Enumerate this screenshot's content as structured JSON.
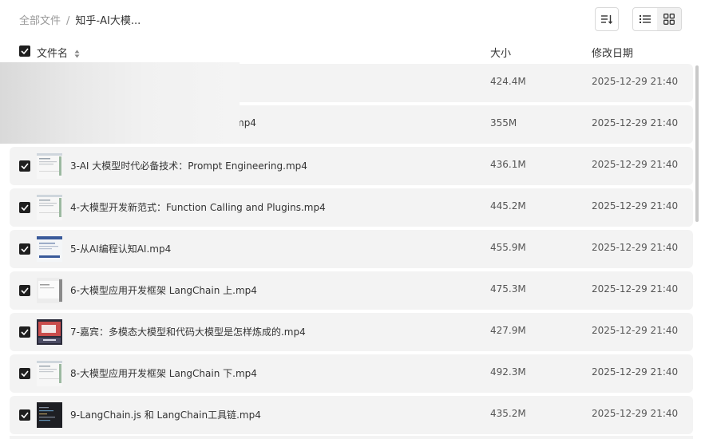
{
  "breadcrumb": {
    "root": "全部文件",
    "separator": "/",
    "current": "知乎-AI大模..."
  },
  "columns": {
    "name": "文件名",
    "size": "大小",
    "modified": "修改日期"
  },
  "files": [
    {
      "name": "",
      "name_suffix": "",
      "size": "424.4M",
      "date": "2025-12-29 21:40",
      "checked": true,
      "thumb": "blurred"
    },
    {
      "name": "",
      "name_suffix": "mp4",
      "size": "355M",
      "date": "2025-12-29 21:40",
      "checked": true,
      "thumb": "blurred"
    },
    {
      "name": "3-AI 大模型时代必备技术：Prompt Engineering.mp4",
      "size": "436.1M",
      "date": "2025-12-29 21:40",
      "checked": true,
      "thumb": "light"
    },
    {
      "name": "4-大模型开发新范式：Function Calling and Plugins.mp4",
      "size": "445.2M",
      "date": "2025-12-29 21:40",
      "checked": true,
      "thumb": "light"
    },
    {
      "name": "5-从AI编程认知AI.mp4",
      "size": "455.9M",
      "date": "2025-12-29 21:40",
      "checked": true,
      "thumb": "slide-blue"
    },
    {
      "name": "6-大模型应用开发框架 LangChain 上.mp4",
      "size": "475.3M",
      "date": "2025-12-29 21:40",
      "checked": true,
      "thumb": "light-gray"
    },
    {
      "name": "7-嘉宾：多模态大模型和代码大模型是怎样炼成的.mp4",
      "size": "427.9M",
      "date": "2025-12-29 21:40",
      "checked": true,
      "thumb": "red-slide"
    },
    {
      "name": "8-大模型应用开发框架 LangChain 下.mp4",
      "size": "492.3M",
      "date": "2025-12-29 21:40",
      "checked": true,
      "thumb": "light"
    },
    {
      "name": "9-LangChain.js 和 LangChain工具链.mp4",
      "size": "435.2M",
      "date": "2025-12-29 21:40",
      "checked": true,
      "thumb": "dark-code"
    }
  ],
  "icons": {
    "sort": "sort-icon",
    "list_view": "list-view-icon",
    "grid_view": "grid-view-icon",
    "checkbox": "checkbox-checked-icon"
  },
  "colors": {
    "row_bg": "#f3f3f3",
    "checkbox": "#1f1f1f",
    "text": "#333333",
    "muted": "#999999"
  }
}
